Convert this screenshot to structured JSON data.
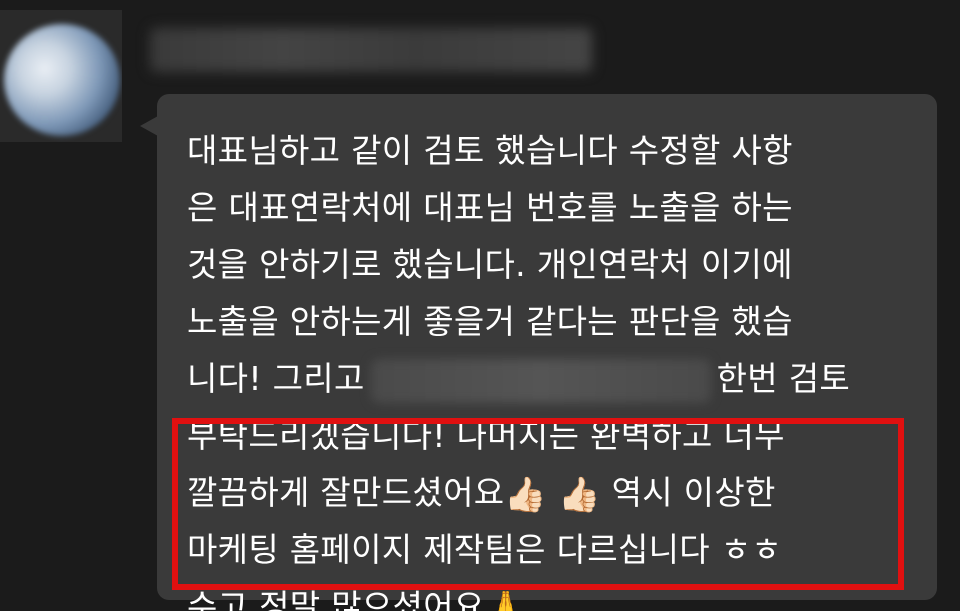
{
  "chat": {
    "message": {
      "line1": "대표님하고 같이 검토 했습니다 수정할 사항",
      "line2": "은 대표연락처에 대표님 번호를 노출을 하는",
      "line3": "것을 안하기로 했습니다. 개인연락처 이기에",
      "line4": "노출을 안하는게 좋을거 같다는 판단을 했습",
      "line5_before": "니다! 그리고",
      "line5_after": "한번 검토",
      "line6": "부탁드리겠습니다! 나머지는 완벽하고 너무",
      "line7_before": "깔끔하게 잘만드셨어요",
      "line7_emoji": "👍🏻 👍🏻",
      "line7_after": " 역시 이상한",
      "line8": "마케팅 홈페이지 제작팀은 다르십니다 ㅎㅎ",
      "line9_before": "수고 정말 많으셨어요",
      "line9_emoji": "🙏"
    }
  }
}
